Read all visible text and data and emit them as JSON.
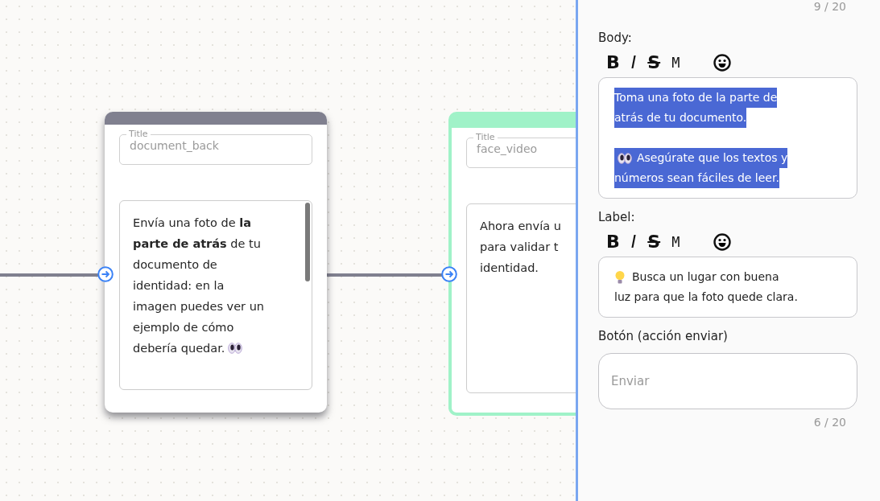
{
  "canvas": {
    "nodes": [
      {
        "color": "#80808f",
        "title_label": "Title",
        "title_value": "document_back",
        "message_lines": [
          "Envía una foto de **la**",
          "**parte de atrás** de tu",
          "documento de",
          "identidad: en la",
          "imagen puedes ver un",
          "ejemplo de cómo",
          "debería quedar."
        ],
        "selected": true
      },
      {
        "color": "#a0f2c8",
        "title_label": "Title",
        "title_value": "face_video",
        "message_lines": [
          "Ahora envía u",
          "para validar t",
          "identidad."
        ],
        "selected": false
      }
    ]
  },
  "panel": {
    "title_counter": "9 / 20",
    "body": {
      "label": "Body:",
      "toolbar": [
        {
          "kind": "bold",
          "label": "B"
        },
        {
          "kind": "italic",
          "label": "I"
        },
        {
          "kind": "strike",
          "label": "S"
        },
        {
          "kind": "mono",
          "label": "M"
        },
        {
          "kind": "emoji"
        }
      ],
      "paragraphs": [
        {
          "kind": "plain",
          "lines": [
            "Toma una foto de la parte de",
            "atrás de tu documento."
          ]
        },
        {
          "kind": "note",
          "lines": [
            "Asegúrate que los textos y",
            "números sean fáciles de leer."
          ]
        }
      ],
      "selected": true
    },
    "label": {
      "label": "Label:",
      "toolbar": [
        {
          "kind": "bold",
          "label": "B"
        },
        {
          "kind": "italic",
          "label": "I"
        },
        {
          "kind": "strike",
          "label": "S"
        },
        {
          "kind": "mono",
          "label": "M"
        },
        {
          "kind": "emoji"
        }
      ],
      "paragraphs": [
        {
          "kind": "note",
          "lines": [
            "Busca un lugar con buena",
            "luz para que la foto quede clara."
          ]
        }
      ],
      "selected": false
    },
    "button_field": {
      "label": "Botón (acción enviar)",
      "placeholder": "Enviar",
      "counter": "6 / 20"
    }
  }
}
